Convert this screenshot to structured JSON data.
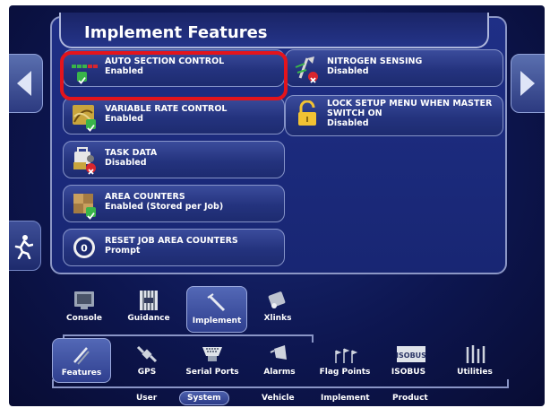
{
  "panel": {
    "title": "Implement Features"
  },
  "features": [
    {
      "title": "AUTO SECTION CONTROL",
      "status": "Enabled",
      "state": "enabled",
      "icon": "section-bar-icon"
    },
    {
      "title": "VARIABLE RATE CONTROL",
      "status": "Enabled",
      "state": "enabled",
      "icon": "variable-rate-icon"
    },
    {
      "title": "TASK DATA",
      "status": "Disabled",
      "state": "disabled",
      "icon": "task-data-icon"
    },
    {
      "title": "AREA COUNTERS",
      "status": "Enabled (Stored per Job)",
      "state": "enabled",
      "icon": "area-counter-icon"
    },
    {
      "title": "RESET JOB AREA COUNTERS",
      "status": "Prompt",
      "state": "prompt",
      "icon": "reset-counter-icon"
    },
    {
      "title": "NITROGEN SENSING",
      "status": "Disabled",
      "state": "disabled",
      "icon": "nitrogen-sensor-icon"
    },
    {
      "title_line1": "LOCK SETUP MENU WHEN MASTER",
      "title_line2": "SWITCH ON",
      "status": "Disabled",
      "state": "disabled",
      "icon": "lock-icon"
    }
  ],
  "config_tabs": [
    {
      "label": "Console",
      "icon": "console-icon",
      "selected": false
    },
    {
      "label": "Guidance",
      "icon": "guidance-icon",
      "selected": false
    },
    {
      "label": "Implement",
      "icon": "implement-icon",
      "selected": true
    },
    {
      "label": "Xlinks",
      "icon": "xlinks-icon",
      "selected": false
    }
  ],
  "section_tabs": [
    {
      "label": "Features",
      "icon": "features-icon",
      "selected": true
    },
    {
      "label": "GPS",
      "icon": "gps-icon",
      "selected": false
    },
    {
      "label": "Serial Ports",
      "icon": "serial-port-icon",
      "selected": false
    },
    {
      "label": "Alarms",
      "icon": "alarm-icon",
      "selected": false
    },
    {
      "label": "Flag Points",
      "icon": "flag-points-icon",
      "selected": false
    },
    {
      "label": "ISOBUS",
      "icon": "isobus-icon",
      "selected": false
    },
    {
      "label": "Utilities",
      "icon": "utilities-icon",
      "selected": false
    }
  ],
  "categories": [
    {
      "label": "User",
      "selected": false
    },
    {
      "label": "System",
      "selected": true
    },
    {
      "label": "Vehicle",
      "selected": false
    },
    {
      "label": "Implement",
      "selected": false
    },
    {
      "label": "Product",
      "selected": false
    }
  ],
  "isobus_icon_text": "ISOBUS",
  "colors": {
    "enabled": "#39b54a",
    "disabled": "#d9262e",
    "highlight": "#e3141c",
    "background": "#0d1650"
  }
}
